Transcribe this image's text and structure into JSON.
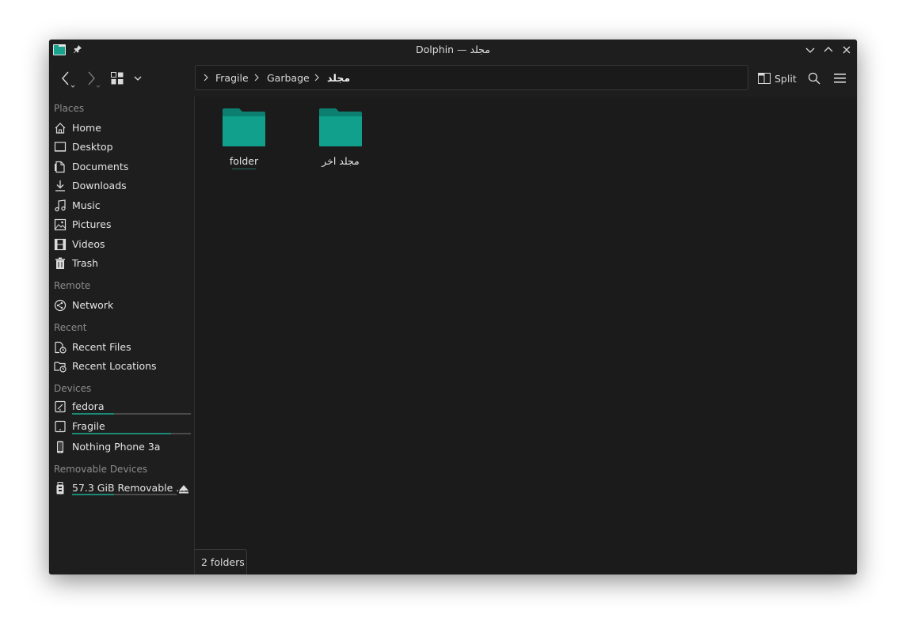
{
  "window": {
    "title": "Dolphin — مجلد"
  },
  "toolbar": {
    "back_icon": "back-icon",
    "forward_icon": "forward-icon",
    "view_mode_icon": "icon-view-icon",
    "split_label": "Split",
    "search_icon": "search-icon",
    "menu_icon": "hamburger-menu-icon"
  },
  "breadcrumb": {
    "items": [
      "Fragile",
      "Garbage",
      "مجلد"
    ]
  },
  "sidebar": {
    "places_title": "Places",
    "places": [
      {
        "label": "Home",
        "icon": "home-icon"
      },
      {
        "label": "Desktop",
        "icon": "desktop-icon"
      },
      {
        "label": "Documents",
        "icon": "documents-icon"
      },
      {
        "label": "Downloads",
        "icon": "downloads-icon"
      },
      {
        "label": "Music",
        "icon": "music-icon"
      },
      {
        "label": "Pictures",
        "icon": "pictures-icon"
      },
      {
        "label": "Videos",
        "icon": "videos-icon"
      },
      {
        "label": "Trash",
        "icon": "trash-icon"
      }
    ],
    "remote_title": "Remote",
    "remote": [
      {
        "label": "Network",
        "icon": "network-icon"
      }
    ],
    "recent_title": "Recent",
    "recent": [
      {
        "label": "Recent Files",
        "icon": "recent-files-icon"
      },
      {
        "label": "Recent Locations",
        "icon": "recent-locations-icon"
      }
    ],
    "devices_title": "Devices",
    "devices": [
      {
        "label": "fedora",
        "icon": "drive-icon",
        "usage_fraction": 0.35
      },
      {
        "label": "Fragile",
        "icon": "drive-icon",
        "usage_fraction": 0.83
      },
      {
        "label": "Nothing Phone 3a",
        "icon": "phone-icon"
      }
    ],
    "removable_title": "Removable Devices",
    "removable": [
      {
        "label": "57.3 GiB Removable ...",
        "icon": "usb-drive-icon",
        "usage_fraction": 0.4
      }
    ]
  },
  "content": {
    "folders": [
      {
        "name": "folder",
        "icon": "folder-icon"
      },
      {
        "name": "مجلد اخر",
        "icon": "folder-icon"
      }
    ]
  },
  "status": {
    "text": "2 folders"
  },
  "colors": {
    "accent": "#1d8a78",
    "folder": "#10a08c",
    "window_bg": "#1b1b1b"
  }
}
